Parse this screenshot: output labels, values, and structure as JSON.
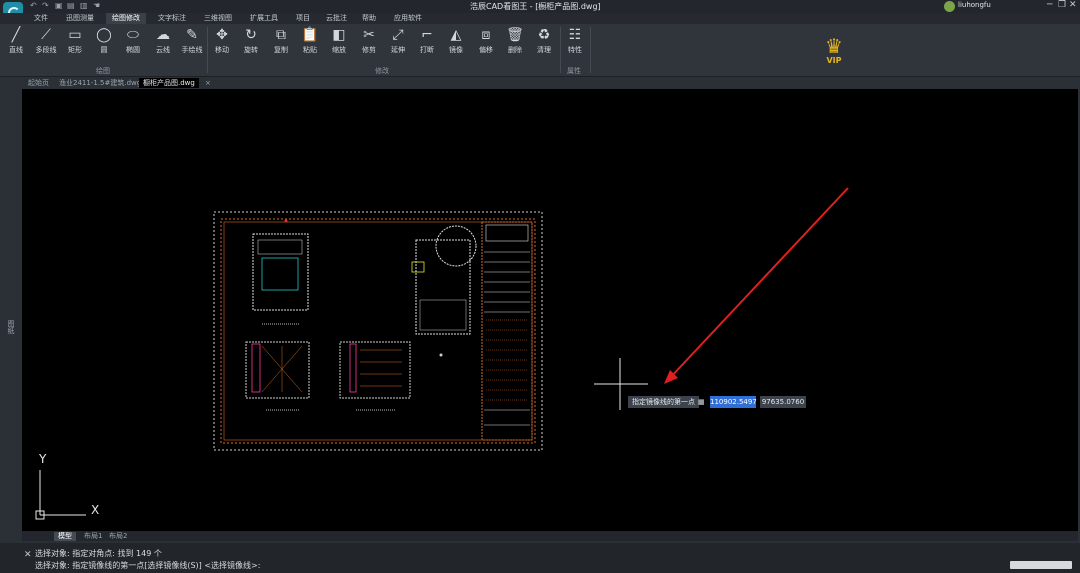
{
  "app": {
    "title": "浩辰CAD看图王 - [橱柜产品图.dwg]",
    "user": "liuhongfu"
  },
  "menus": [
    "文件",
    "迅图测量",
    "绘图修改",
    "文字标注",
    "三维视图",
    "扩展工具",
    "项目",
    "云批注",
    "帮助",
    "应用软件"
  ],
  "ribbon": {
    "draw": [
      "直线",
      "多段线",
      "矩形",
      "圆",
      "椭圆",
      "云线",
      "手绘线"
    ],
    "draw_group": "绘图",
    "modify": [
      "移动",
      "旋转",
      "复制",
      "粘贴",
      "缩放",
      "修剪",
      "延伸",
      "打断",
      "镜像",
      "偏移",
      "删除",
      "清理"
    ],
    "modify_group": "修改",
    "props": "特性",
    "props_group": "属性",
    "vip": "VIP"
  },
  "doc_tabs": [
    "起始页",
    "渔业2411-1.5#建筑.dwg",
    "橱柜产品图.dwg"
  ],
  "side_label": "图纸",
  "layout_tabs": [
    "模型",
    "布局1",
    "布局2"
  ],
  "command": {
    "line1": "选择对象: 指定对角点: 找到 149 个",
    "line2": "选择对象:  指定镜像线的第一点[选择镜像线(S)] <选择镜像线>:"
  },
  "tooltip": {
    "label": "指定镜像线的第一点",
    "x": "110902.5497",
    "y": "97635.0760"
  },
  "ucs": {
    "x": "X",
    "y": "Y"
  },
  "colors": {
    "accent": "#2f6fd6",
    "arrow": "#e02020",
    "border": "#d46a1f"
  }
}
